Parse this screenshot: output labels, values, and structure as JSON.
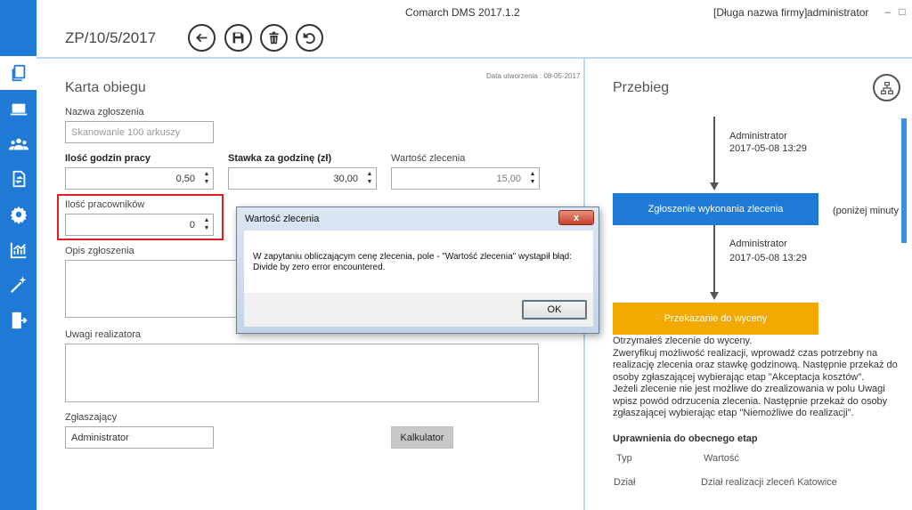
{
  "window": {
    "app_title": "Comarch DMS 2017.1.2",
    "company": "[Długa nazwa firmy]",
    "user": "administrator",
    "minimize": "–",
    "maximize": "□",
    "close": "✕"
  },
  "header": {
    "document_number": "ZP/10/5/2017"
  },
  "sidebar": {
    "items": [
      "documents-icon",
      "desktop-icon",
      "users-icon",
      "sync-document-icon",
      "gear-icon",
      "chart-icon",
      "magic-wand-icon",
      "exit-icon"
    ]
  },
  "form": {
    "title": "Karta obiegu",
    "date_created": "Data utworzenia : 08-05-2017",
    "name_label": "Nazwa zgłoszenia",
    "name_placeholder": "Skanowanie 100 arkuszy",
    "hours_label": "Ilość godzin pracy",
    "hours_value": "0,50",
    "rate_label": "Stawka za godzinę (zł)",
    "rate_value": "30,00",
    "order_value_label": "Wartość zlecenia",
    "order_value": "15,00",
    "workers_label": "Ilość pracowników",
    "workers_value": "0",
    "description_label": "Opis zgłoszenia",
    "notes_label": "Uwagi realizatora",
    "requester_label": "Zgłaszający",
    "requester_value": "Administrator",
    "calculator_button": "Kalkulator"
  },
  "flow": {
    "title": "Przebieg",
    "step1_user": "Administrator",
    "step1_date": "2017-05-08 13:29",
    "stage1_label": "Zgłoszenie wykonania zlecenia",
    "stage1_note": "(poniżej minuty",
    "step2_user": "Administrator",
    "step2_date": "2017-05-08 13:29",
    "stage2_label": "Przekazanie do wyceny",
    "stage1_color": "#1f7ad6",
    "stage2_color": "#f2a900",
    "description": [
      "Otrzymałeś zlecenie do wyceny.",
      "Zweryfikuj możliwość realizacji, wprowadź czas potrzebny na realizację zlecenia oraz stawkę godzinową. Następnie przekaż do osoby zgłaszającej wybierając etap \"Akceptacja kosztów\".",
      "Jeżeli zlecenie nie jest możliwe do zrealizowania w polu Uwagi wpisz powód odrzucenia zlecenia. Następnie przekaż do osoby zgłaszającej wybierając etap \"Niemożliwe do realizacji\"."
    ],
    "permissions_title": "Uprawnienia do obecnego etap",
    "perm_row1_key": "Typ",
    "perm_row1_value": "Wartość",
    "perm_row2_key": "Dział",
    "perm_row2_value": "Dział realizacji zleceń Katowice"
  },
  "dialog": {
    "title": "Wartość zlecenia",
    "close": "x",
    "message_line1": "W zapytaniu obliczającym cenę zlecenia, pole - \"Wartość zlecenia\" wystąpił błąd:",
    "message_line2": "Divide by zero error encountered.",
    "ok_button": "OK"
  }
}
